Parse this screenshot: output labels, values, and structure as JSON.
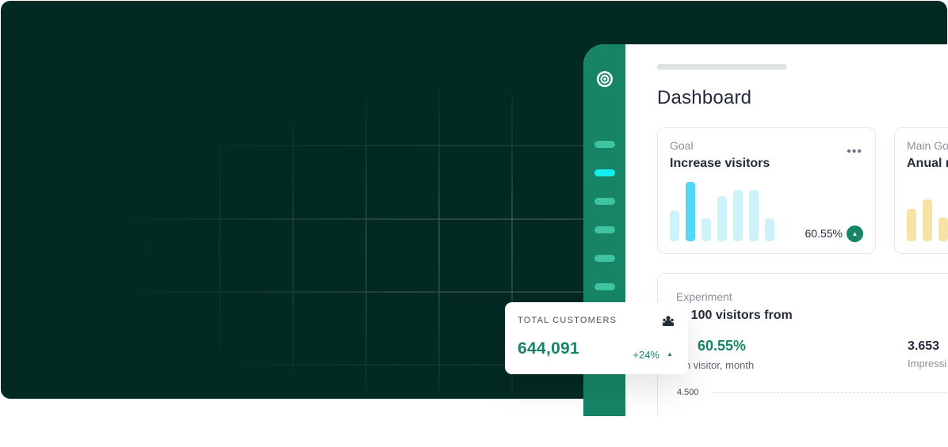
{
  "dashboard": {
    "title": "Dashboard",
    "goal_card": {
      "label": "Goal",
      "heading": "Increase visitors",
      "more_icon": "ellipsis-icon",
      "percent": "60.55%",
      "trend_icon": "arrow-up-icon",
      "bar_levels": [
        0.52,
        1.0,
        0.38,
        0.76,
        0.86,
        0.86,
        0.38
      ],
      "bar_highlight_index": 1,
      "bar_color": "#cdf2fb",
      "bar_highlight_color": "#55d7f6"
    },
    "main_goal_card": {
      "label": "Main Go",
      "heading": "Anual r",
      "bar_levels": [
        0.55,
        0.7,
        0.4
      ],
      "bar_color": "#f7e3a6"
    },
    "experiment_card": {
      "label": "Experiment",
      "heading": "et 100 visitors from",
      "percent": "60.55%",
      "sub": "om visitor, month",
      "count": "3.653",
      "count_label": "Impressi",
      "axis_tick": "4.500"
    }
  },
  "sidebar": {
    "logo_icon": "target-icon",
    "active_index": 1,
    "item_count": 6
  },
  "customers_card": {
    "label": "TOTAL CUSTOMERS",
    "icon": "users-icon",
    "value": "644,091",
    "change": "+24%",
    "trend_icon": "arrow-up-icon"
  },
  "colors": {
    "hero_bg": "#032a22",
    "sidebar": "#178565",
    "accent": "#178565",
    "active_pill": "#12eef0"
  }
}
